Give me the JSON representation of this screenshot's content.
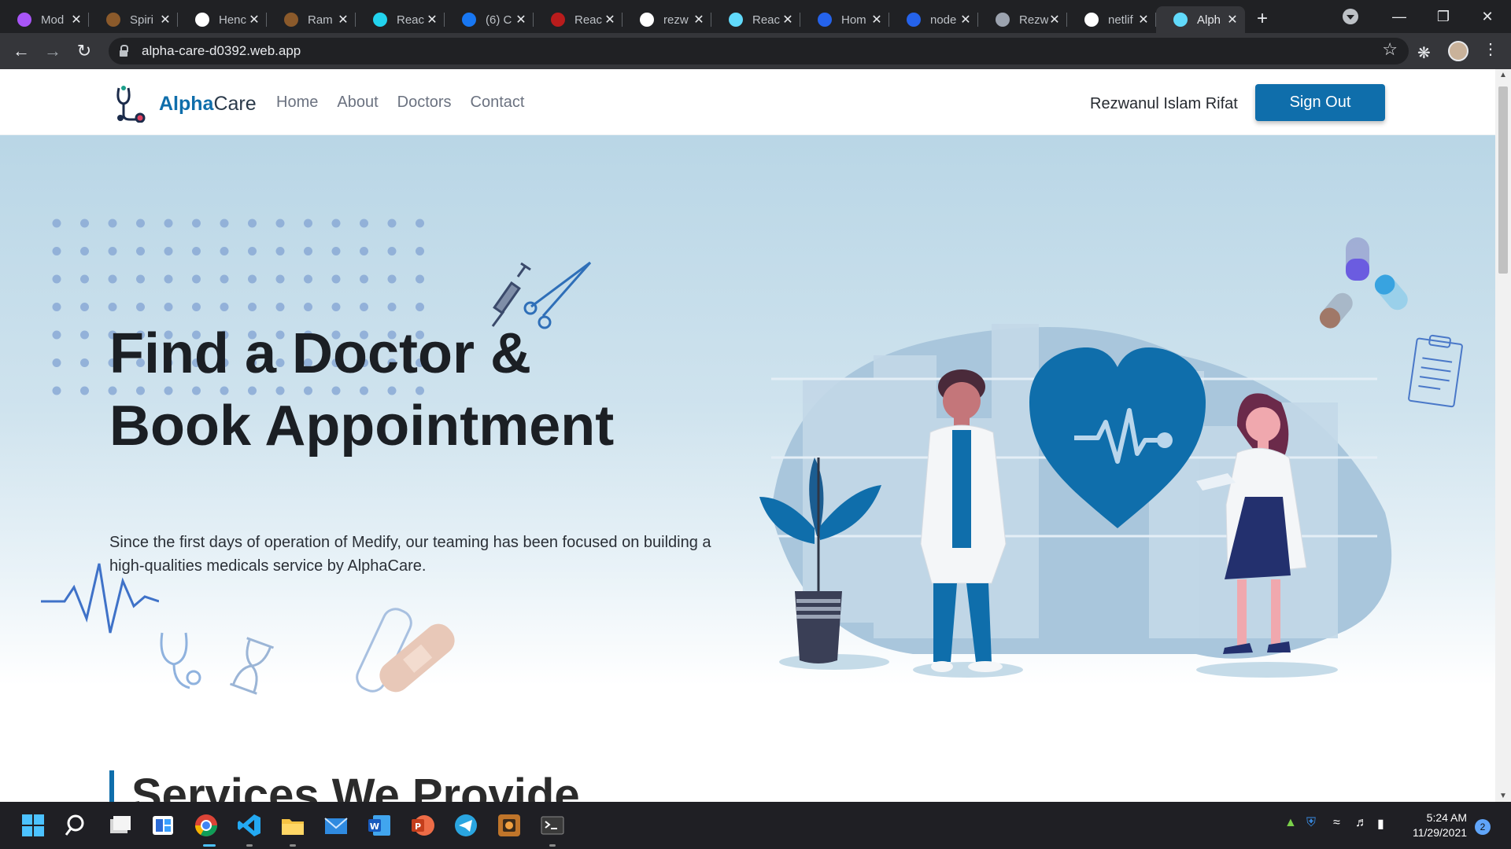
{
  "browser": {
    "tabs": [
      {
        "label": "Mod",
        "color": "#a855f7"
      },
      {
        "label": "Spiri",
        "color": "#8b5a2b"
      },
      {
        "label": "Henc",
        "color": "#ffffff"
      },
      {
        "label": "Ram",
        "color": "#8b5a2b"
      },
      {
        "label": "Reac",
        "color": "#22d3ee"
      },
      {
        "label": "(6) C",
        "color": "#1877f2"
      },
      {
        "label": "Reac",
        "color": "#b91c1c"
      },
      {
        "label": "rezw",
        "color": "#ffffff"
      },
      {
        "label": "Reac",
        "color": "#61dafb"
      },
      {
        "label": "Hom",
        "color": "#2563eb"
      },
      {
        "label": "node",
        "color": "#2563eb"
      },
      {
        "label": "Rezw",
        "color": "#9ca3af"
      },
      {
        "label": "netlif",
        "color": "#ffffff"
      },
      {
        "label": "Alph",
        "color": "#61dafb",
        "active": true
      }
    ],
    "url": "alpha-care-d0392.web.app"
  },
  "site": {
    "brand_part1": "Alpha",
    "brand_part2": "Care",
    "nav": [
      "Home",
      "About",
      "Doctors",
      "Contact"
    ],
    "user_name": "Rezwanul Islam Rifat",
    "signout_label": "Sign Out"
  },
  "hero": {
    "title_line1": "Find a Doctor &",
    "title_line2": "Book Appointment",
    "subtitle": "Since the first days of operation of Medify, our teaming has been focused on building a high-qualities medicals service by AlphaCare."
  },
  "services": {
    "title": "Services We Provide"
  },
  "taskbar": {
    "time": "5:24 AM",
    "date": "11/29/2021",
    "notifications": "2"
  },
  "colors": {
    "brand": "#0f6eab",
    "hero_bg": "#b9d6e6"
  }
}
